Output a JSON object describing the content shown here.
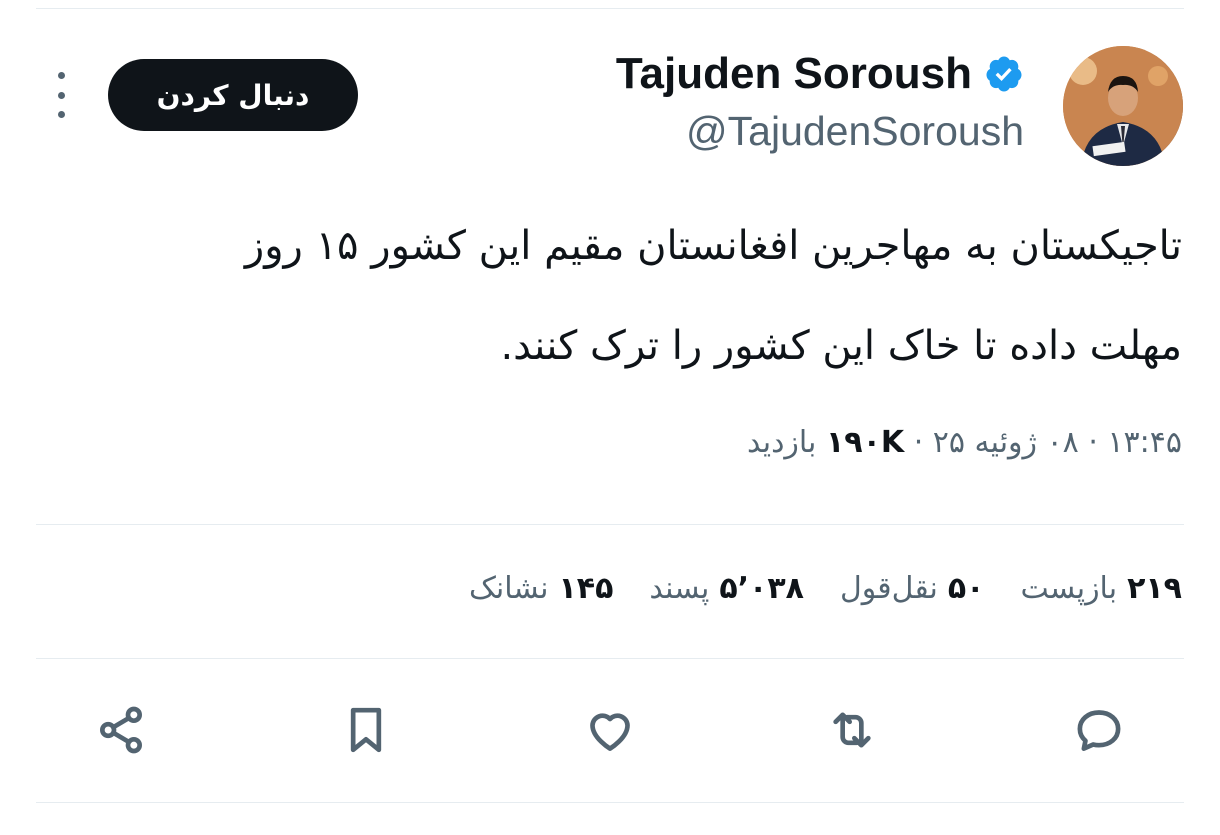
{
  "author": {
    "name": "Tajuden Soroush",
    "handle": "@TajudenSoroush",
    "verified_color": "#1d9bf0"
  },
  "follow_button": {
    "label": "دنبال کردن"
  },
  "more_icon": "more-vertical-icon",
  "tweet": {
    "text": "تاجیکستان به مهاجرین افغانستان مقیم این کشور ۱۵ روز\nمهلت داده تا خاک این کشور را ترک کنند."
  },
  "meta": {
    "time": "۱۳:۴۵",
    "separator": "·",
    "date": "۰۸ ژوئیه ۲۵",
    "views_count": "۱۹۰K",
    "views_label": "بازدید"
  },
  "stats": [
    {
      "count": "۲۱۹",
      "label": "بازپست"
    },
    {
      "count": "۵۰",
      "label": "نقل‌قول"
    },
    {
      "count": "۵٬۰۳۸",
      "label": "پسند"
    },
    {
      "count": "۱۴۵",
      "label": "نشانک"
    }
  ],
  "actions": [
    {
      "icon": "reply-icon"
    },
    {
      "icon": "retweet-icon"
    },
    {
      "icon": "like-icon"
    },
    {
      "icon": "bookmark-icon"
    },
    {
      "icon": "share-icon"
    }
  ],
  "colors": {
    "text": "#0f1419",
    "secondary": "#536471",
    "divider": "#e6ecf0",
    "follow_bg": "#0f1419"
  }
}
